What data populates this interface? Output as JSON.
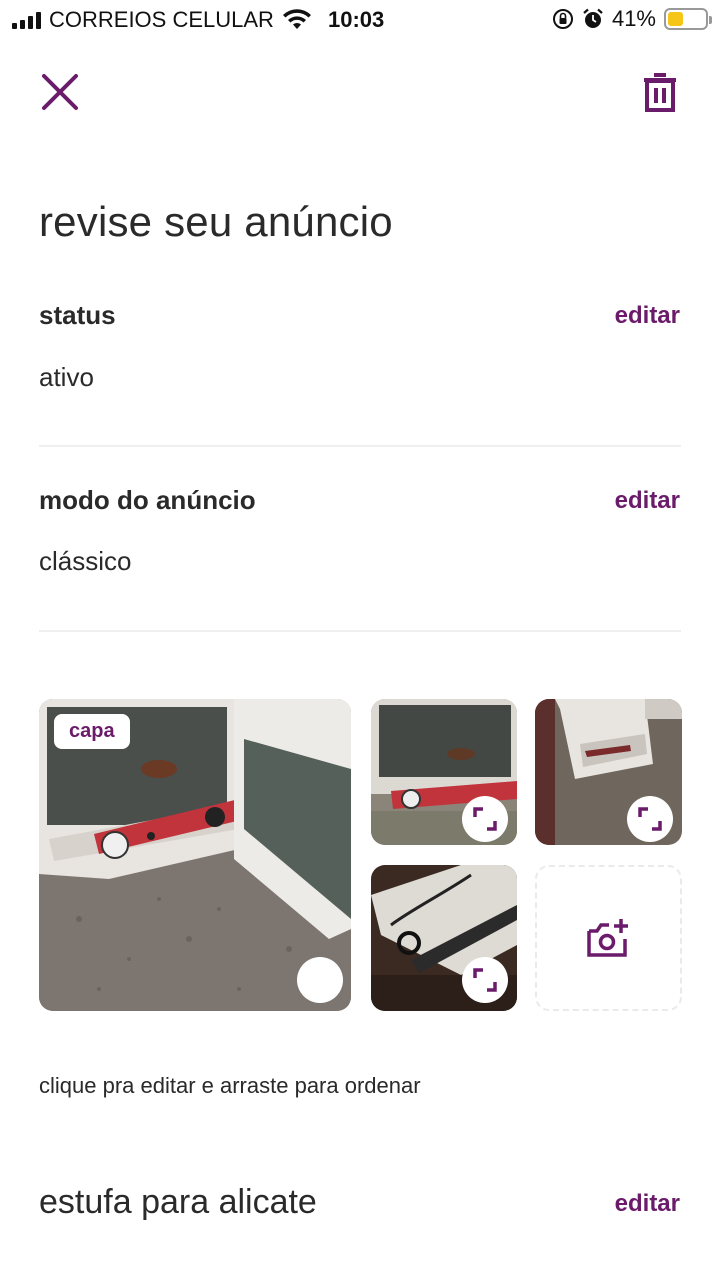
{
  "status_bar": {
    "carrier": "CORREIOS CELULAR",
    "time": "10:03",
    "battery_percent_label": "41%",
    "battery_level": 0.41,
    "icons": [
      "signal-icon",
      "wifi-icon",
      "orientation-lock-icon",
      "alarm-icon",
      "battery-icon"
    ]
  },
  "header": {
    "close_icon": "close-icon",
    "delete_icon": "trash-icon"
  },
  "title": "revise seu anúncio",
  "sections": {
    "status": {
      "label": "status",
      "value": "ativo",
      "edit_label": "editar"
    },
    "mode": {
      "label": "modo do anúncio",
      "value": "clássico",
      "edit_label": "editar"
    }
  },
  "photos": {
    "cover_badge": "capa",
    "items": [
      "cover-photo",
      "photo-2",
      "photo-3",
      "photo-4"
    ],
    "add_icon": "add-photo-camera-icon",
    "hint": "clique pra editar e arraste para ordenar"
  },
  "product": {
    "title": "estufa para alicate",
    "edit_label": "editar"
  },
  "colors": {
    "accent": "#6a1b6a",
    "text": "#2a2a2a",
    "battery": "#f5c518"
  }
}
